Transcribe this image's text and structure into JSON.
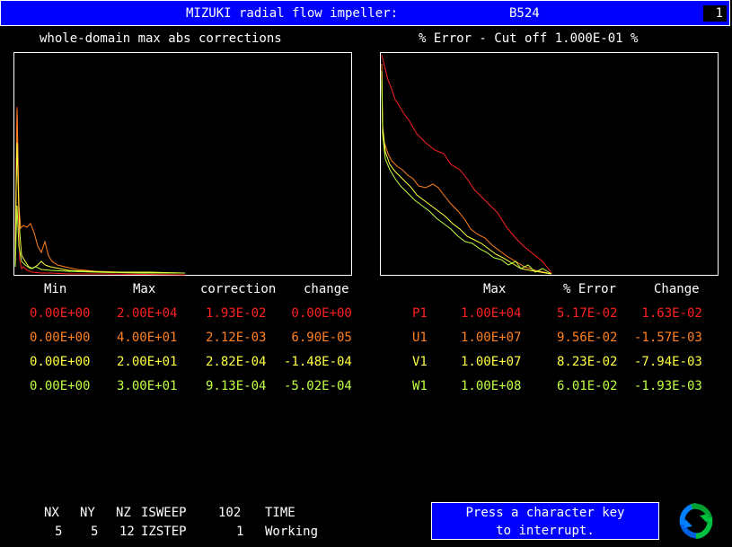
{
  "window": {
    "title": "MIZUKI radial flow impeller:",
    "run_id": "B524",
    "badge": "1"
  },
  "left_plot": {
    "title": "whole-domain max abs corrections"
  },
  "right_plot": {
    "title": "% Error - Cut off 1.000E-01 %"
  },
  "left_table": {
    "headers": {
      "min": "Min",
      "max": "Max",
      "correction": "correction",
      "change": "change"
    },
    "rows": [
      {
        "min": "0.00E+00",
        "max": "2.00E+04",
        "correction": "1.93E-02",
        "change": " 0.00E+00",
        "color": "#ff2020"
      },
      {
        "min": "0.00E+00",
        "max": "4.00E+01",
        "correction": "2.12E-03",
        "change": " 6.90E-05",
        "color": "#ff8020"
      },
      {
        "min": "0.00E+00",
        "max": "2.00E+01",
        "correction": "2.82E-04",
        "change": "-1.48E-04",
        "color": "#ffff40"
      },
      {
        "min": "0.00E+00",
        "max": "3.00E+01",
        "correction": "9.13E-04",
        "change": "-5.02E-04",
        "color": "#c0ff40"
      }
    ]
  },
  "right_table": {
    "headers": {
      "max": "Max",
      "error": "% Error",
      "change": "Change"
    },
    "rows": [
      {
        "var": "P1",
        "max": "1.00E+04",
        "error": "5.17E-02",
        "change": " 1.63E-02",
        "color": "#ff2020"
      },
      {
        "var": "U1",
        "max": "1.00E+07",
        "error": "9.56E-02",
        "change": "-1.57E-03",
        "color": "#ff8020"
      },
      {
        "var": "V1",
        "max": "1.00E+07",
        "error": "8.23E-02",
        "change": "-7.94E-03",
        "color": "#ffff40"
      },
      {
        "var": "W1",
        "max": "1.00E+08",
        "error": "6.01E-02",
        "change": "-1.93E-03",
        "color": "#c0ff40"
      }
    ]
  },
  "status": {
    "nx_label": "NX",
    "ny_label": "NY",
    "nz_label": "NZ",
    "isweep_label": "ISWEEP",
    "isweep_value": "102",
    "time_label": "TIME",
    "nx": "5",
    "ny": "5",
    "nz": "12",
    "izstep_label": "IZSTEP",
    "izstep_value": "1",
    "time_value": "Working"
  },
  "interrupt": {
    "line1": "Press a character key",
    "line2": "to interrupt."
  },
  "logo": {
    "icon": "phoenics-logo-icon",
    "colors": [
      "#0080ff",
      "#00c040"
    ]
  }
}
